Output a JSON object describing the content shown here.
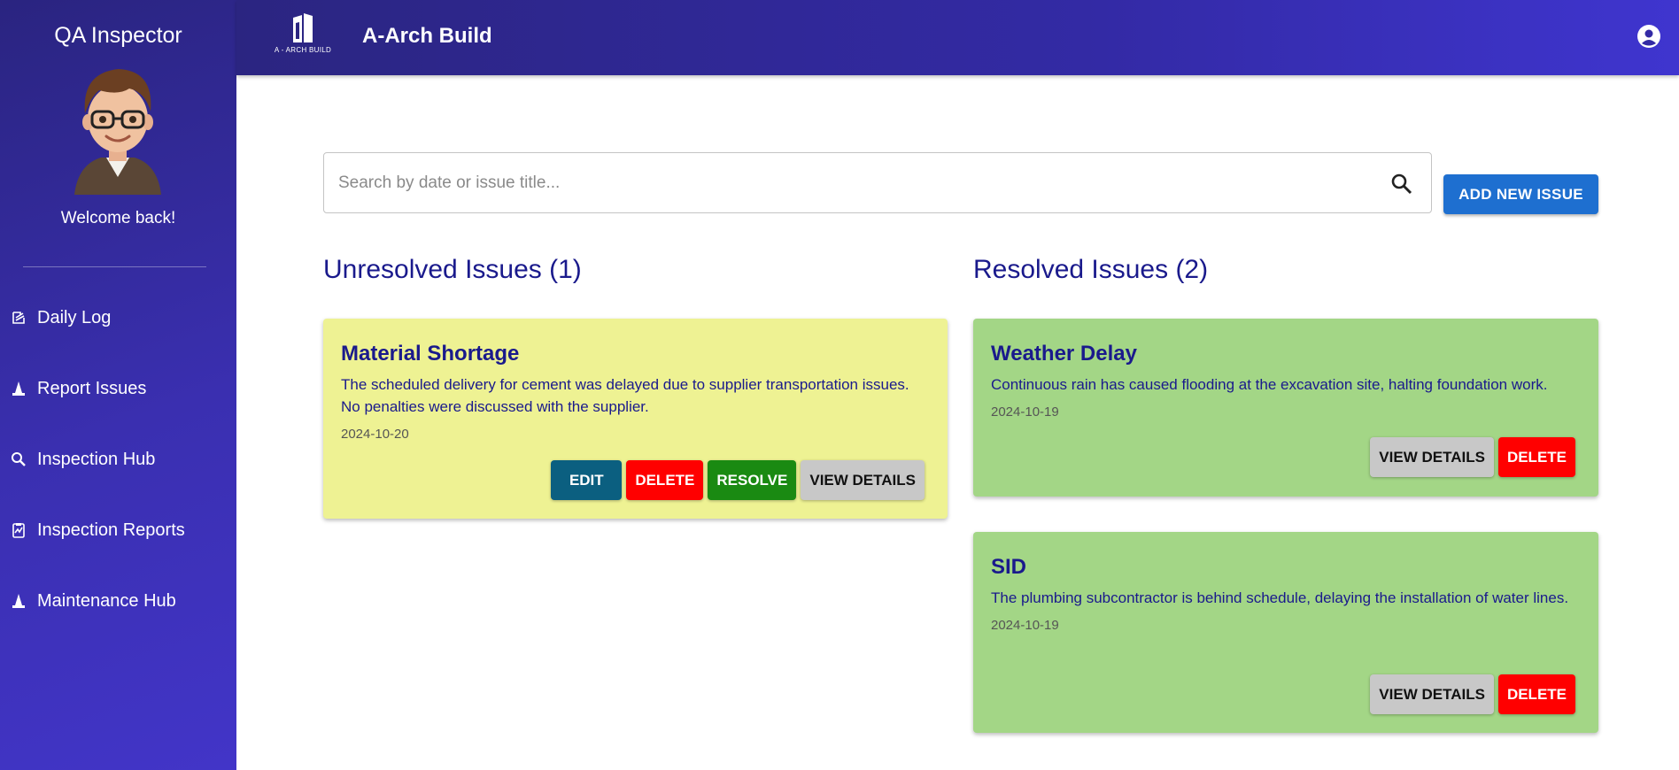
{
  "sidebar": {
    "role": "QA Inspector",
    "welcome": "Welcome back!",
    "items": [
      {
        "label": "Daily Log",
        "icon": "daily-log-icon"
      },
      {
        "label": "Report Issues",
        "icon": "cone-icon"
      },
      {
        "label": "Inspection Hub",
        "icon": "search-magnifier-icon"
      },
      {
        "label": "Inspection Reports",
        "icon": "report-clipboard-icon"
      },
      {
        "label": "Maintenance Hub",
        "icon": "cone-icon"
      }
    ]
  },
  "header": {
    "logo_text": "A - ARCH BUILD",
    "brand": "A-Arch Build",
    "account_icon": "account-circle-icon"
  },
  "search": {
    "placeholder": "Search by date or issue title...",
    "value": ""
  },
  "actions": {
    "add_label": "ADD NEW ISSUE"
  },
  "unresolved": {
    "title": "Unresolved Issues (1)",
    "cards": [
      {
        "title": "Material Shortage",
        "description": "The scheduled delivery for cement was delayed due to supplier transportation issues. No penalties were discussed with the supplier.",
        "date": "2024-10-20",
        "buttons": {
          "edit": "EDIT",
          "delete": "DELETE",
          "resolve": "RESOLVE",
          "view": "VIEW DETAILS"
        }
      }
    ]
  },
  "resolved": {
    "title": "Resolved Issues (2)",
    "cards": [
      {
        "title": "Weather Delay",
        "description": "Continuous rain has caused flooding at the excavation site, halting foundation work.",
        "date": "2024-10-19",
        "buttons": {
          "view": "VIEW DETAILS",
          "delete": "DELETE"
        }
      },
      {
        "title": "SID",
        "description": "The plumbing subcontractor is behind schedule, delaying the installation of water lines.",
        "date": "2024-10-19",
        "buttons": {
          "view": "VIEW DETAILS",
          "delete": "DELETE"
        }
      }
    ]
  },
  "colors": {
    "sidebar": "#3a2fb0",
    "unresolved_card": "#eef293",
    "resolved_card": "#a3d686",
    "heading": "#1a1a8c",
    "primary_button": "#1e6fd0",
    "delete": "#ff0000",
    "resolve": "#1a8a12",
    "edit": "#0b5f80"
  }
}
